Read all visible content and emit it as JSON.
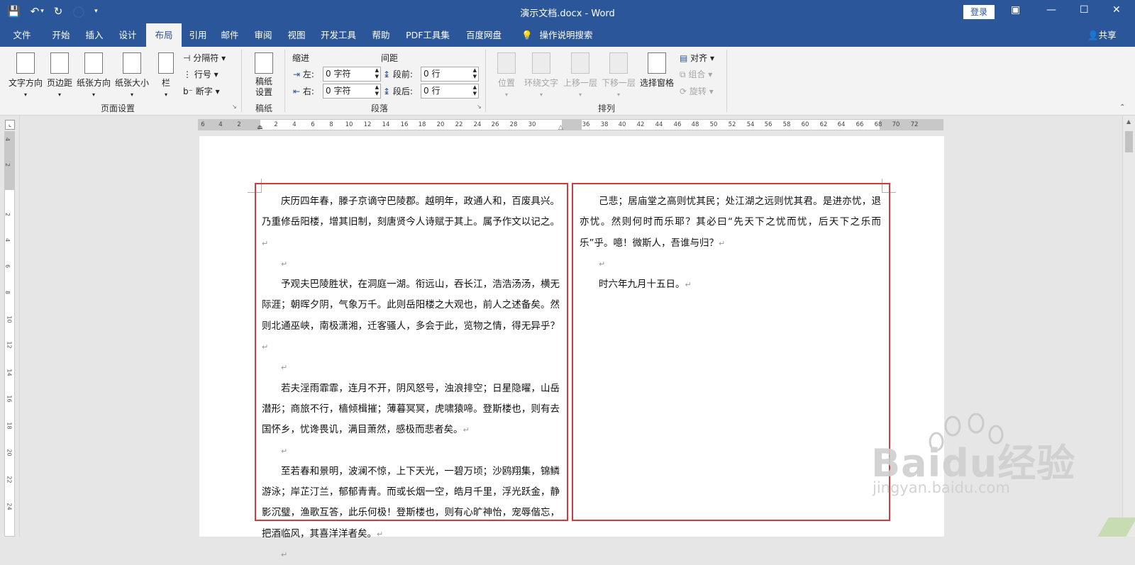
{
  "titlebar": {
    "doc_title": "演示文档.docx - Word",
    "login": "登录",
    "qat": {
      "save": "💾",
      "undo": "↶",
      "undo_dropdown": "▾",
      "redo": "↻",
      "custom": "◯",
      "more": "▾"
    },
    "window": {
      "ribbon_options": "▣",
      "minimize": "—",
      "maximize": "☐",
      "close": "✕"
    }
  },
  "tabs": [
    {
      "label": "文件"
    },
    {
      "label": "开始"
    },
    {
      "label": "插入"
    },
    {
      "label": "设计"
    },
    {
      "label": "布局"
    },
    {
      "label": "引用"
    },
    {
      "label": "邮件"
    },
    {
      "label": "审阅"
    },
    {
      "label": "视图"
    },
    {
      "label": "开发工具"
    },
    {
      "label": "帮助"
    },
    {
      "label": "PDF工具集"
    },
    {
      "label": "百度网盘"
    }
  ],
  "tell_me": {
    "icon": "lightbulb-icon",
    "label": "操作说明搜索"
  },
  "share": "共享",
  "ribbon": {
    "page_setup": {
      "text_direction": "文字方向",
      "margins": "页边距",
      "orientation": "纸张方向",
      "size": "纸张大小",
      "columns": "栏",
      "breaks": "分隔符",
      "line_numbers": "行号",
      "hyphenation": "断字",
      "group_label": "页面设置"
    },
    "draft": {
      "paper_setup": "稿纸设置",
      "group_label": "稿纸"
    },
    "paragraph": {
      "indent_header": "缩进",
      "spacing_header": "间距",
      "left_label": "左:",
      "left_value": "0 字符",
      "right_label": "右:",
      "right_value": "0 字符",
      "before_label": "段前:",
      "before_value": "0 行",
      "after_label": "段后:",
      "after_value": "0 行",
      "group_label": "段落"
    },
    "arrange": {
      "position": "位置",
      "wrap_text": "环绕文字",
      "bring_forward": "上移一层",
      "send_backward": "下移一层",
      "selection_pane": "选择窗格",
      "align": "对齐",
      "group": "组合",
      "rotate": "旋转",
      "group_label": "排列"
    }
  },
  "ruler": {
    "h_ticks": [
      "6",
      "4",
      "2",
      "2",
      "4",
      "6",
      "8",
      "10",
      "12",
      "14",
      "16",
      "18",
      "20",
      "22",
      "24",
      "26",
      "28",
      "30",
      "36",
      "38",
      "40",
      "42",
      "44",
      "46",
      "48",
      "50",
      "52",
      "54",
      "56",
      "58",
      "60",
      "62",
      "64",
      "66",
      "68",
      "70",
      "72"
    ],
    "v_ticks": [
      "4",
      "2",
      "2",
      "4",
      "6",
      "8",
      "10",
      "12",
      "14",
      "16",
      "18",
      "20",
      "22",
      "24"
    ]
  },
  "document": {
    "col1": [
      "庆历四年春，滕子京谪守巴陵郡。越明年，政通人和，百废具兴。乃重修岳阳楼，增其旧制，刻唐贤今人诗赋于其上。属予作文以记之。",
      "",
      "予观夫巴陵胜状，在洞庭一湖。衔远山，吞长江，浩浩汤汤，横无际涯；朝晖夕阴，气象万千。此则岳阳楼之大观也，前人之述备矣。然则北通巫峡，南极潇湘，迁客骚人，多会于此，览物之情，得无异乎？",
      "",
      "若夫淫雨霏霏，连月不开，阴风怒号，浊浪排空；日星隐曜，山岳潜形；商旅不行，樯倾楫摧；薄暮冥冥，虎啸猿啼。登斯楼也，则有去国怀乡，忧谗畏讥，满目萧然，感极而悲者矣。",
      "",
      "至若春和景明，波澜不惊，上下天光，一碧万顷；沙鸥翔集，锦鳞游泳；岸芷汀兰，郁郁青青。而或长烟一空，皓月千里，浮光跃金，静影沉璧，渔歌互答，此乐何极！登斯楼也，则有心旷神怡，宠辱偕忘，把酒临风，其喜洋洋者矣。",
      ""
    ],
    "col2": [
      "己悲；居庙堂之高则忧其民；处江湖之远则忧其君。是进亦忧，退亦忧。然则何时而乐耶？其必曰“先天下之忧而忧，后天下之乐而乐”乎。噫！微斯人，吾谁与归？",
      "",
      "时六年九月十五日。"
    ],
    "para_mark": "↵"
  },
  "watermark": {
    "text": "Baidu经验",
    "url": "jingyan.baidu.com"
  }
}
